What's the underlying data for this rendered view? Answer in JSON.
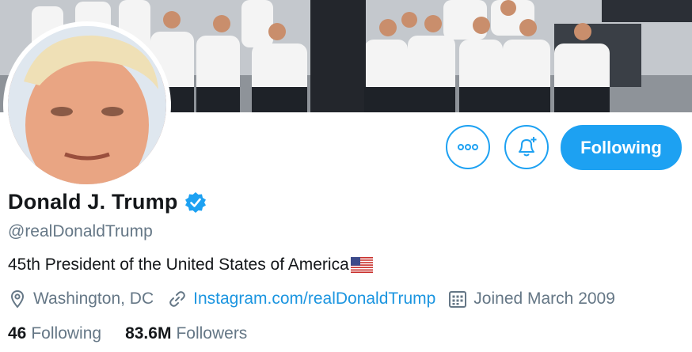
{
  "profile": {
    "display_name": "Donald J. Trump",
    "handle": "@realDonaldTrump",
    "bio": "45th President of the United States of America",
    "location": "Washington, DC",
    "website": "Instagram.com/realDonaldTrump",
    "joined": "Joined March 2009"
  },
  "actions": {
    "follow_label": "Following"
  },
  "stats": {
    "following_count": "46",
    "following_label": "Following",
    "followers_count": "83.6M",
    "followers_label": "Followers"
  },
  "icons": {
    "more": "more-icon",
    "notifications": "bell-plus-icon",
    "verified": "verified-badge-icon",
    "location": "location-pin-icon",
    "link": "link-icon",
    "calendar": "calendar-icon",
    "flag": "us-flag-icon"
  },
  "colors": {
    "accent": "#1da1f2",
    "link": "#1b95e0",
    "secondary_text": "#657786",
    "primary_text": "#14171a"
  }
}
